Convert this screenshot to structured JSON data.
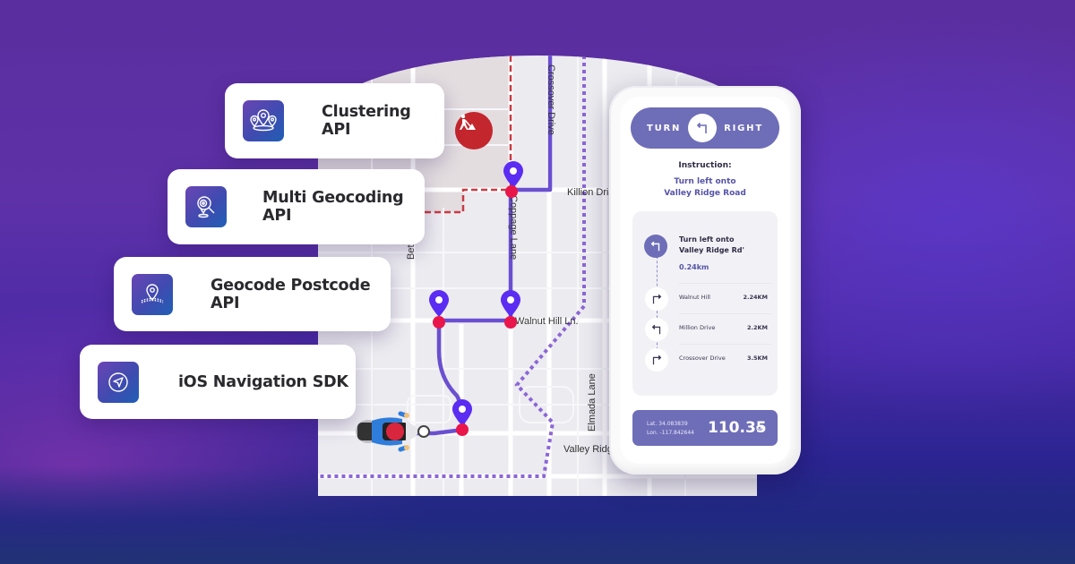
{
  "theme": {
    "accent": "#6e6db8",
    "route_color": "#6a4fd0",
    "pin_color": "#5b2cf2",
    "node_color": "#e8164a",
    "construction_color": "#c4262e"
  },
  "api_cards": [
    {
      "label": "Clustering API",
      "icon": "cluster-pins-icon"
    },
    {
      "label": "Multi Geocoding API",
      "icon": "geocode-search-icon"
    },
    {
      "label": "Geocode Postcode API",
      "icon": "location-pin-area-icon"
    },
    {
      "label": "iOS Navigation SDK",
      "icon": "navigation-arrow-icon"
    }
  ],
  "map": {
    "streets": {
      "top_vertical": "Crossover Drive",
      "killion": "Killion Dri",
      "coppage": "Coppage Lane",
      "bet": "Bet",
      "walnut": "Walnut Hill Ln.",
      "elmada": "Elmada Lane",
      "valley": "Valley Ridg"
    },
    "markers": {
      "construction": "construction-worker-icon",
      "rider": "scooter-rider-icon"
    }
  },
  "phone": {
    "turn_left_text": "TURN",
    "turn_right_text": "RIGHT",
    "instruction_title": "Instruction:",
    "instruction_line1": "Turn left onto",
    "instruction_line2": "Valley Ridge Road",
    "current_step": {
      "line1": "Turn left onto",
      "line2": "Valley Ridge Rd'",
      "distance": "0.24km",
      "icon": "turn-left-icon"
    },
    "steps": [
      {
        "name": "Walnut Hill",
        "distance": "2.24KM",
        "icon": "turn-right-icon"
      },
      {
        "name": "Million Drive",
        "distance": "2.2KM",
        "icon": "turn-left-icon"
      },
      {
        "name": "Crossover Drive",
        "distance": "3.5KM",
        "icon": "turn-right-icon"
      }
    ],
    "latitude": "Lat. 34.083839",
    "longitude": "Lon. -117.842644",
    "total_distance": "110.35",
    "total_distance_unit": "KM"
  }
}
